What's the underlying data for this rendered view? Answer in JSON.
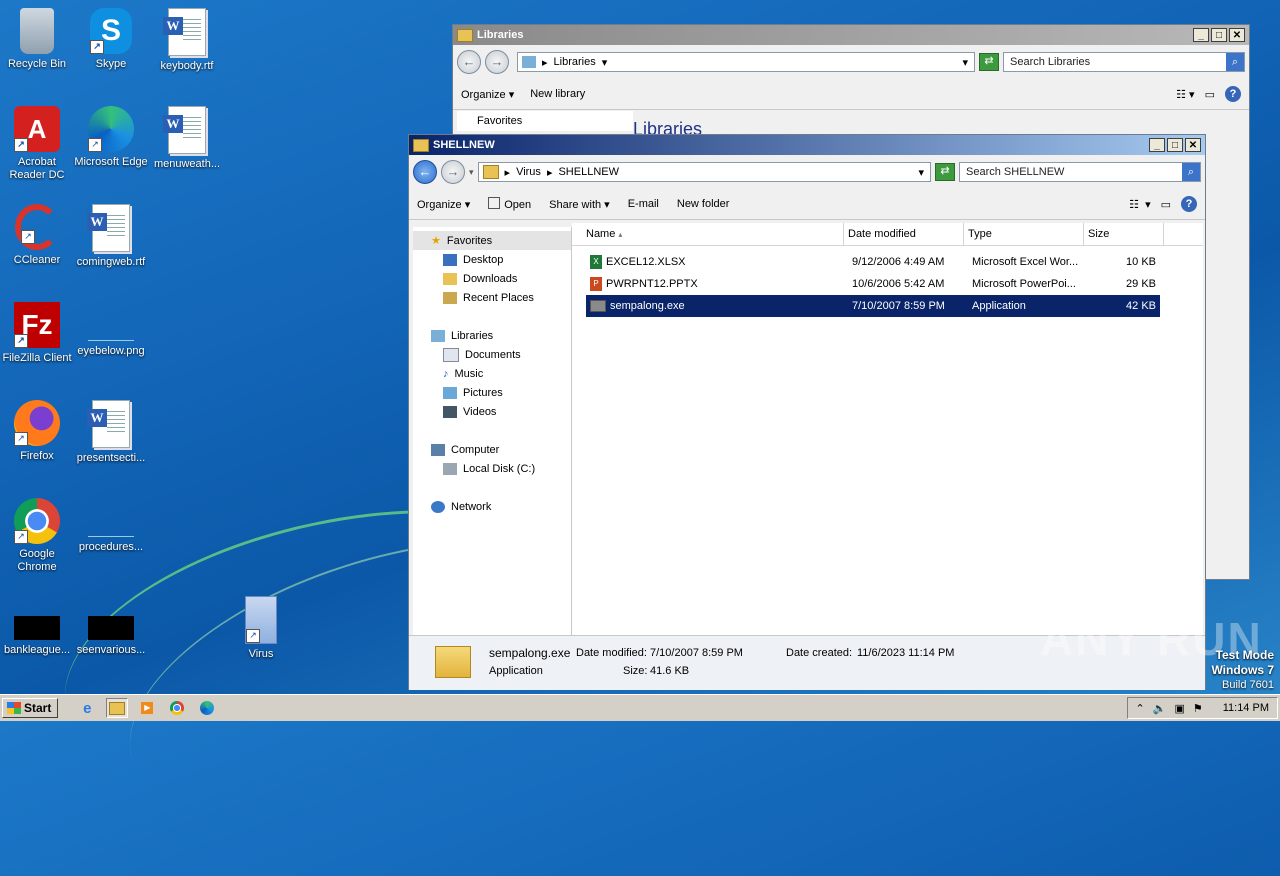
{
  "desktop": {
    "icons": [
      {
        "label": "Recycle Bin"
      },
      {
        "label": "Skype"
      },
      {
        "label": "keybody.rtf"
      },
      {
        "label": "Acrobat Reader DC"
      },
      {
        "label": "Microsoft Edge"
      },
      {
        "label": "menuweath..."
      },
      {
        "label": "CCleaner"
      },
      {
        "label": "comingweb.rtf"
      },
      {
        "label": "FileZilla Client"
      },
      {
        "label": "eyebelow.png"
      },
      {
        "label": "Firefox"
      },
      {
        "label": "presentsecti..."
      },
      {
        "label": "Google Chrome"
      },
      {
        "label": "procedures..."
      },
      {
        "label": "bankleague..."
      },
      {
        "label": "seenvarious..."
      },
      {
        "label": "Virus"
      }
    ]
  },
  "libraries_window": {
    "title": "Libraries",
    "address": "Libraries",
    "search_placeholder": "Search Libraries",
    "organize": "Organize",
    "new_library": "New library",
    "nav_favorites": "Favorites",
    "heading": "Libraries"
  },
  "shellnew_window": {
    "title": "SHELLNEW",
    "breadcrumb": [
      "Virus",
      "SHELLNEW"
    ],
    "search_placeholder": "Search SHELLNEW",
    "toolbar": {
      "organize": "Organize",
      "open": "Open",
      "share_with": "Share with",
      "email": "E-mail",
      "new_folder": "New folder"
    },
    "nav": {
      "favorites": "Favorites",
      "desktop": "Desktop",
      "downloads": "Downloads",
      "recent_places": "Recent Places",
      "libraries": "Libraries",
      "documents": "Documents",
      "music": "Music",
      "pictures": "Pictures",
      "videos": "Videos",
      "computer": "Computer",
      "local_disk": "Local Disk (C:)",
      "network": "Network"
    },
    "columns": {
      "name": "Name",
      "date": "Date modified",
      "type": "Type",
      "size": "Size"
    },
    "files": [
      {
        "name": "EXCEL12.XLSX",
        "date": "9/12/2006 4:49 AM",
        "type": "Microsoft Excel Wor...",
        "size": "10 KB",
        "icon": "excel-file-icon"
      },
      {
        "name": "PWRPNT12.PPTX",
        "date": "10/6/2006 5:42 AM",
        "type": "Microsoft PowerPoi...",
        "size": "29 KB",
        "icon": "powerpoint-file-icon"
      },
      {
        "name": "sempalong.exe",
        "date": "7/10/2007 8:59 PM",
        "type": "Application",
        "size": "42 KB",
        "icon": "exe-file-icon"
      }
    ],
    "details": {
      "name": "sempalong.exe",
      "kind": "Application",
      "date_modified_label": "Date modified:",
      "date_modified": "7/10/2007 8:59 PM",
      "size_label": "Size:",
      "size": "41.6 KB",
      "date_created_label": "Date created:",
      "date_created": "11/6/2023 11:14 PM"
    }
  },
  "taskbar": {
    "start": "Start",
    "clock": "11:14 PM"
  },
  "watermark": {
    "brand": "ANY RUN",
    "line1": "Test Mode",
    "line2": "Windows 7",
    "line3": "Build 7601"
  }
}
